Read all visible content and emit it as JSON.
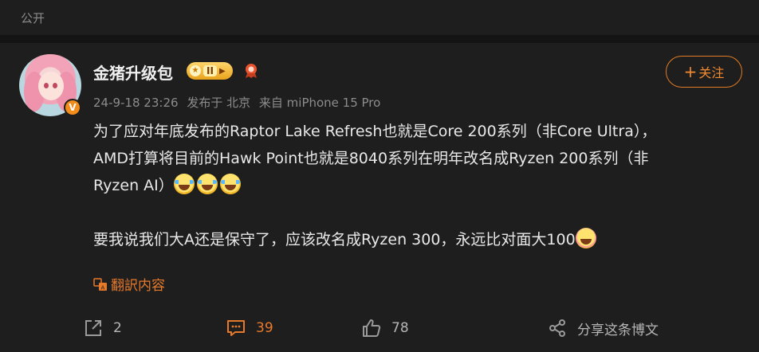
{
  "visibility": "公开",
  "user": {
    "name": "金猪升级包",
    "rank_badge": "II",
    "avatar_badge": "V"
  },
  "follow_button": {
    "label": "关注"
  },
  "meta": {
    "date": "24-9-18 23:26",
    "location": "发布于 北京",
    "source": "来自 miPhone 15 Pro"
  },
  "content": {
    "line1": "为了应对年底发布的Raptor Lake Refresh也就是Core 200系列（非Core Ultra），",
    "line2": "AMD打算将目前的Hawk Point也就是8040系列在明年改名成Ryzen 200系列（非",
    "line3": "Ryzen AI）",
    "line4": "要我说我们大A还是保守了，应该改名成Ryzen 300，永远比对面大100"
  },
  "translate": {
    "label": "翻訳内容"
  },
  "actions": {
    "forward_count": "2",
    "comment_count": "39",
    "like_count": "78",
    "share_label": "分享这条博文"
  },
  "colors": {
    "background": "#1e1e1e",
    "accent": "#e7792a",
    "badge": "#f28c1b"
  }
}
